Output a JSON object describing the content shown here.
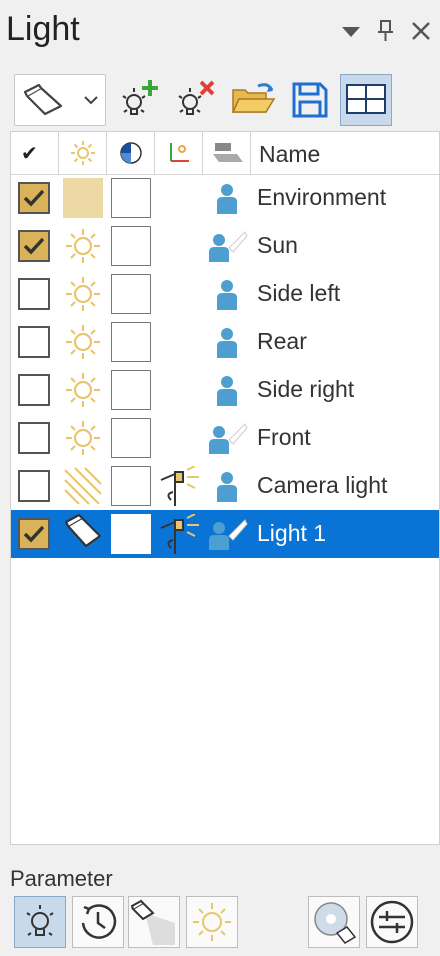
{
  "panel": {
    "title": "Light"
  },
  "titlebar": {
    "menu_icon": "dropdown-arrow-icon",
    "pin_icon": "pin-icon",
    "close_icon": "close-icon"
  },
  "toolbar": {
    "light_type_icon": "spotlight-icon",
    "buttons": [
      {
        "icon": "add-light-icon"
      },
      {
        "icon": "delete-light-icon"
      },
      {
        "icon": "open-folder-icon"
      },
      {
        "icon": "save-icon"
      },
      {
        "icon": "layout-grid-icon",
        "active": true
      }
    ]
  },
  "table": {
    "headers": {
      "enabled": "✔",
      "type": "sun-icon",
      "color": "color-wheel-icon",
      "position": "axis-icon",
      "shadow": "shadow-icon",
      "name": "Name"
    },
    "rows": [
      {
        "name": "Environment",
        "checked": true,
        "type": "environment"
      },
      {
        "name": "Sun",
        "checked": true,
        "type": "sun"
      },
      {
        "name": "Side left",
        "checked": false,
        "type": "sun"
      },
      {
        "name": "Rear",
        "checked": false,
        "type": "sun"
      },
      {
        "name": "Side right",
        "checked": false,
        "type": "sun"
      },
      {
        "name": "Front",
        "checked": false,
        "type": "sun"
      },
      {
        "name": "Camera light",
        "checked": false,
        "type": "directional"
      },
      {
        "name": "Light 1",
        "checked": true,
        "type": "spot",
        "selected": true
      }
    ]
  },
  "parameter": {
    "label": "Parameter",
    "buttons": [
      {
        "icon": "bulb-icon",
        "active": true
      },
      {
        "icon": "clock-icon"
      },
      {
        "icon": "spot-cone-icon"
      },
      {
        "icon": "sun-icon"
      },
      {
        "icon": "material-light-icon"
      },
      {
        "icon": "adjust-sliders-icon"
      }
    ]
  },
  "colors": {
    "accent_selected": "#0a74d6",
    "checkbox_on": "#d9b25a",
    "sun_icon": "#e8c66e",
    "person_icon": "#4d9fd1"
  }
}
